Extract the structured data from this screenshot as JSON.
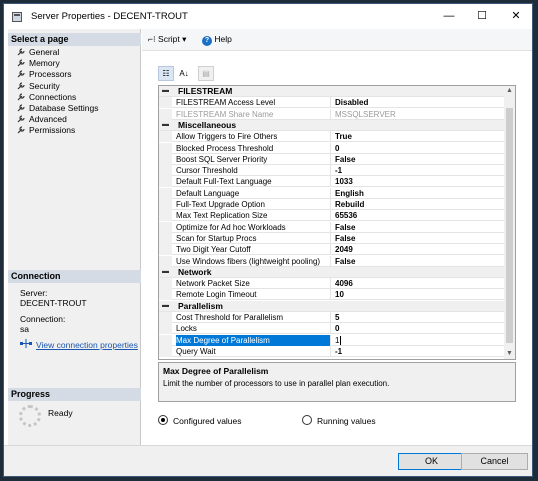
{
  "window": {
    "title": "Server Properties - DECENT-TROUT",
    "minimize_glyph": "—",
    "maximize_glyph": "☐",
    "close_glyph": "✕"
  },
  "left_panel": {
    "select_page_header": "Select a page",
    "pages": [
      {
        "label": "General",
        "icon": "wrench-icon"
      },
      {
        "label": "Memory",
        "icon": "wrench-icon"
      },
      {
        "label": "Processors",
        "icon": "wrench-icon"
      },
      {
        "label": "Security",
        "icon": "wrench-icon"
      },
      {
        "label": "Connections",
        "icon": "wrench-icon"
      },
      {
        "label": "Database Settings",
        "icon": "wrench-icon"
      },
      {
        "label": "Advanced",
        "icon": "wrench-icon"
      },
      {
        "label": "Permissions",
        "icon": "wrench-icon"
      }
    ],
    "connection_header": "Connection",
    "server_label": "Server:",
    "server_value": "DECENT-TROUT",
    "connection_label": "Connection:",
    "connection_value": "sa",
    "view_link": "View connection properties",
    "progress_header": "Progress",
    "progress_status": "Ready"
  },
  "toolbar": {
    "script_label": "Script",
    "help_label": "Help"
  },
  "grid": {
    "sections": [
      {
        "name": "FILESTREAM",
        "rows": [
          {
            "name": "FILESTREAM Access Level",
            "value": "Disabled",
            "dim": false
          },
          {
            "name": "FILESTREAM Share Name",
            "value": "MSSQLSERVER",
            "dim": true
          }
        ]
      },
      {
        "name": "Miscellaneous",
        "rows": [
          {
            "name": "Allow Triggers to Fire Others",
            "value": "True"
          },
          {
            "name": "Blocked Process Threshold",
            "value": "0"
          },
          {
            "name": "Boost SQL Server Priority",
            "value": "False"
          },
          {
            "name": "Cursor Threshold",
            "value": "-1"
          },
          {
            "name": "Default Full-Text Language",
            "value": "1033"
          },
          {
            "name": "Default Language",
            "value": "English"
          },
          {
            "name": "Full-Text Upgrade Option",
            "value": "Rebuild"
          },
          {
            "name": "Max Text Replication Size",
            "value": "65536"
          },
          {
            "name": "Optimize for Ad hoc Workloads",
            "value": "False"
          },
          {
            "name": "Scan for Startup Procs",
            "value": "False"
          },
          {
            "name": "Two Digit Year Cutoff",
            "value": "2049"
          },
          {
            "name": "Use Windows fibers (lightweight pooling)",
            "value": "False"
          }
        ]
      },
      {
        "name": "Network",
        "rows": [
          {
            "name": "Network Packet Size",
            "value": "4096"
          },
          {
            "name": "Remote Login Timeout",
            "value": "10"
          }
        ]
      },
      {
        "name": "Parallelism",
        "rows": [
          {
            "name": "Cost Threshold for Parallelism",
            "value": "5"
          },
          {
            "name": "Locks",
            "value": "0"
          },
          {
            "name": "Max Degree of Parallelism",
            "value": "1",
            "selected": true
          },
          {
            "name": "Query Wait",
            "value": "-1"
          }
        ]
      }
    ]
  },
  "description": {
    "title": "Max Degree of Parallelism",
    "text": "Limit the number of processors to use in parallel plan execution."
  },
  "options": {
    "configured_label": "Configured values",
    "running_label": "Running values",
    "selected": "configured"
  },
  "footer": {
    "ok_label": "OK",
    "cancel_label": "Cancel"
  },
  "colors": {
    "selection": "#0078d7",
    "link": "#1a56b0",
    "panel_header": "#d4dbe5"
  }
}
